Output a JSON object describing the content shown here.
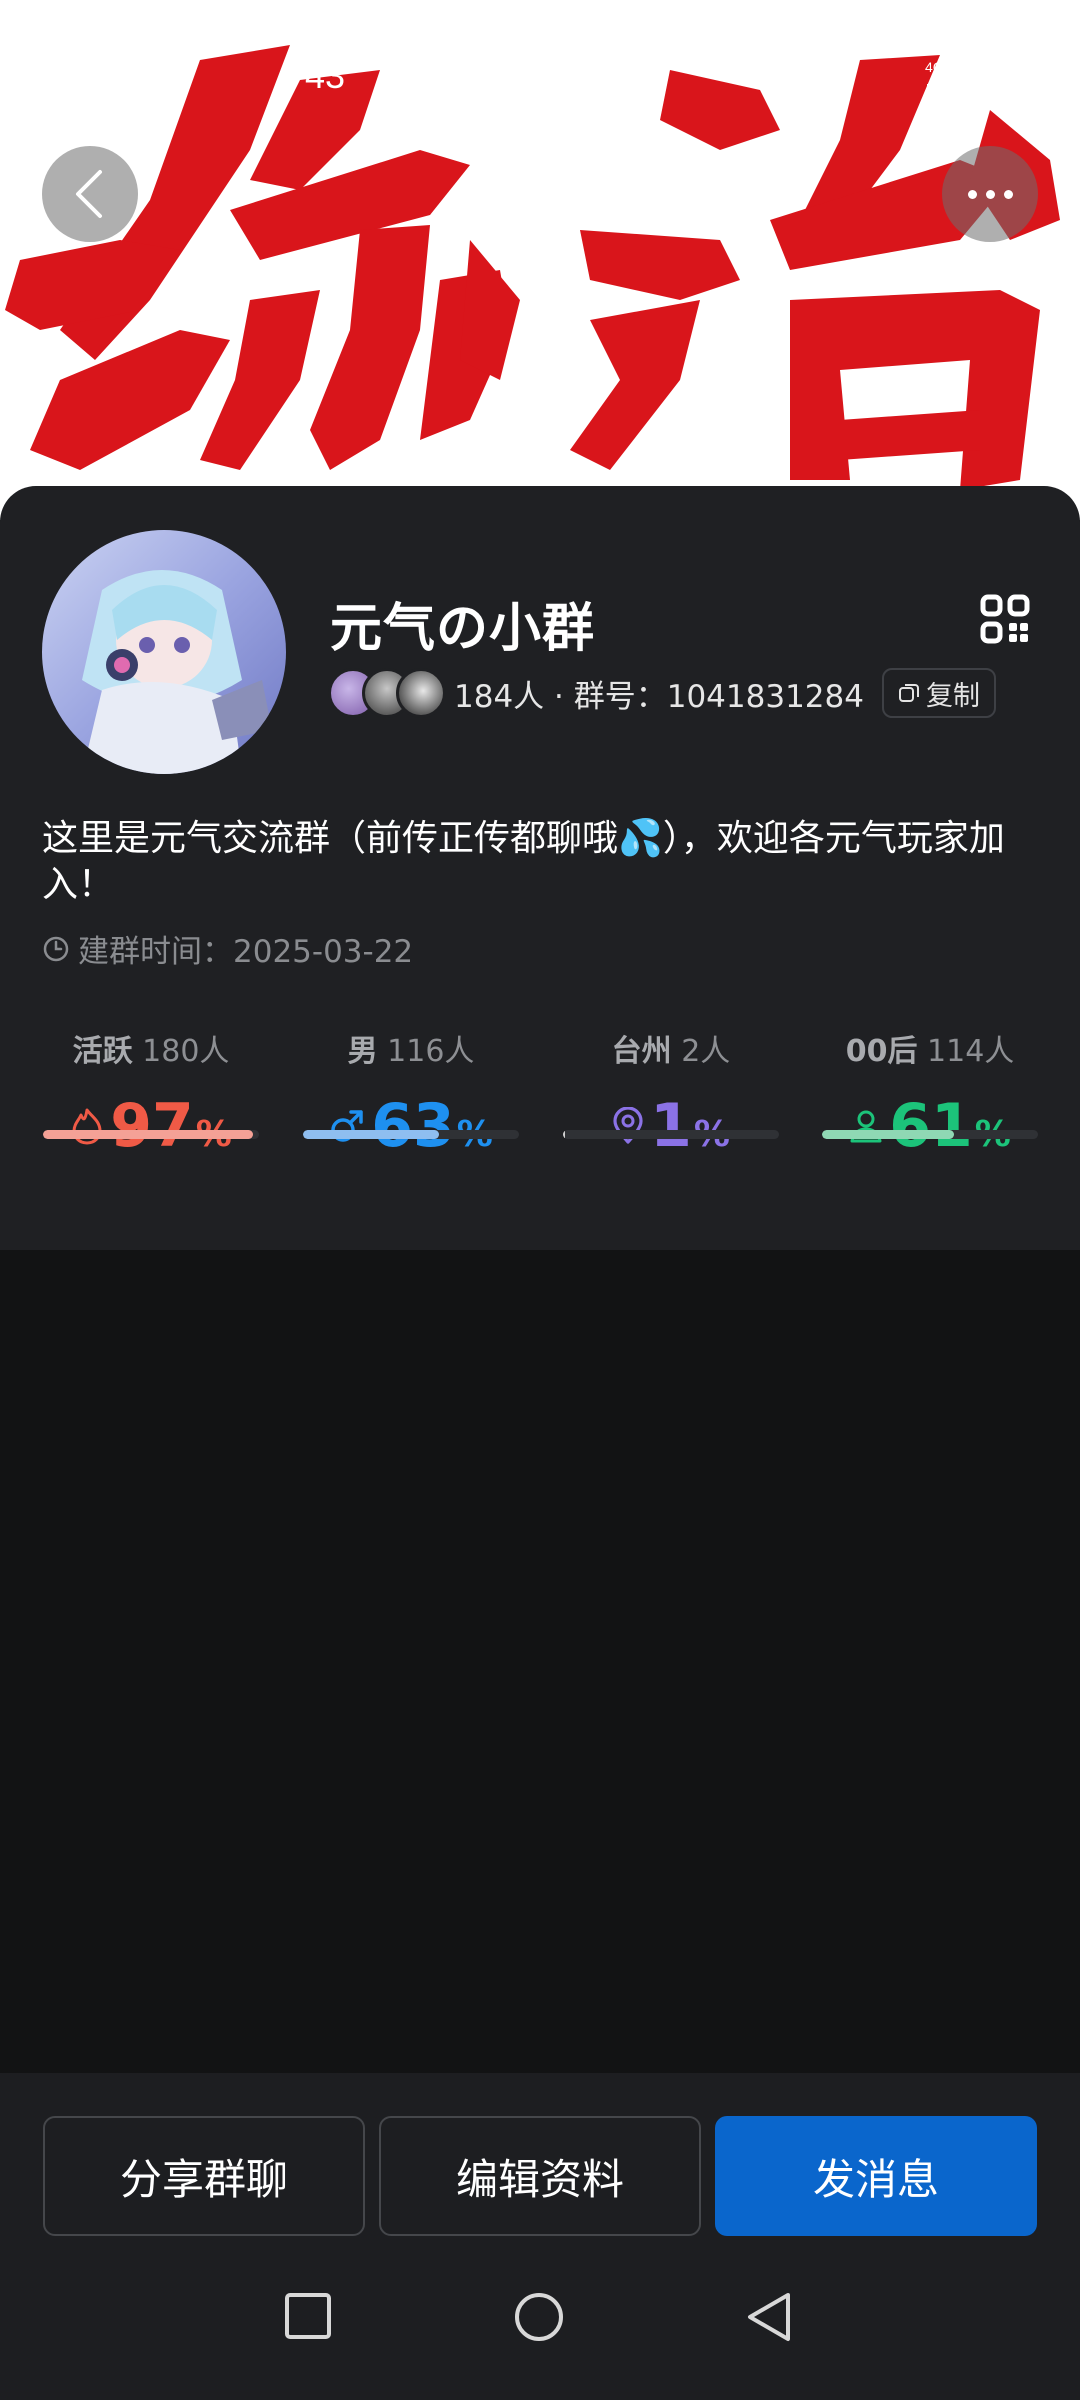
{
  "status_bar": {
    "time": "43"
  },
  "header": {
    "back_icon": "chevron-left-icon",
    "more_icon": "more-dots-icon"
  },
  "group": {
    "name": "元气の小群",
    "meta": "184人 · 群号：1041831284",
    "copy_label": "复制",
    "intro": "这里是元气交流群（前传正传都聊哦💦），欢迎各元气玩家加入！",
    "created": "建群时间：2025-03-22"
  },
  "stats": [
    {
      "label": "活跃",
      "count": "180人",
      "value": "97",
      "unit": "%",
      "icon": "flame-icon",
      "color": "#f05a46",
      "bar_color": "#f4a196",
      "fill": 0.97
    },
    {
      "label": "男",
      "count": "116人",
      "value": "63",
      "unit": "%",
      "icon": "male-icon",
      "color": "#1e90f0",
      "bar_color": "#8fbef0",
      "fill": 0.63
    },
    {
      "label": "台州",
      "count": "2人",
      "value": "1",
      "unit": "%",
      "icon": "location-icon",
      "color": "#8b72e6",
      "bar_color": "#d0d0d0",
      "fill": 0.01
    },
    {
      "label": "00后",
      "count": "114人",
      "value": "61",
      "unit": "%",
      "icon": "person-icon",
      "color": "#1cc37a",
      "bar_color": "#8fd8b4",
      "fill": 0.61
    }
  ],
  "actions": {
    "share": "分享群聊",
    "edit": "编辑资料",
    "message": "发消息"
  }
}
